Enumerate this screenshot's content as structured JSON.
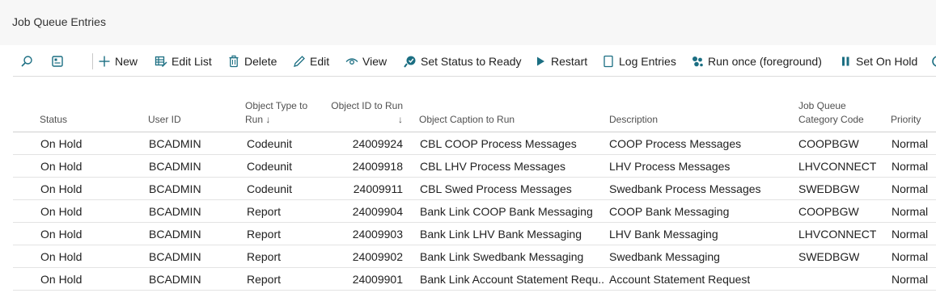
{
  "page": {
    "title": "Job Queue Entries"
  },
  "toolbar": {
    "search_icon": "search-icon",
    "layout_icon": "layout-icon",
    "actions": [
      {
        "label": "New",
        "icon": "plus-icon"
      },
      {
        "label": "Edit List",
        "icon": "edit-list-icon"
      },
      {
        "label": "Delete",
        "icon": "trash-icon"
      },
      {
        "label": "Edit",
        "icon": "pencil-icon"
      },
      {
        "label": "View",
        "icon": "eye-icon"
      },
      {
        "label": "Set Status to Ready",
        "icon": "status-ready-icon"
      },
      {
        "label": "Restart",
        "icon": "play-icon"
      },
      {
        "label": "Log Entries",
        "icon": "log-icon"
      },
      {
        "label": "Run once (foreground)",
        "icon": "run-once-icon"
      },
      {
        "label": "Set On Hold",
        "icon": "pause-icon"
      }
    ],
    "accent": "#1b6e82"
  },
  "table": {
    "headers": {
      "status": "Status",
      "user_id": "User ID",
      "object_type": "Object Type to Run ↓",
      "object_id": "Object ID to Run ↓",
      "caption": "Object Caption to Run",
      "description": "Description",
      "category": "Job Queue Category Code",
      "priority": "Priority"
    },
    "rows": [
      {
        "status": "On Hold",
        "user_id": "BCADMIN",
        "object_type": "Codeunit",
        "object_id": "24009924",
        "caption": "CBL COOP Process Messages",
        "description": "COOP Process Messages",
        "category": "COOPBGW",
        "priority": "Normal"
      },
      {
        "status": "On Hold",
        "user_id": "BCADMIN",
        "object_type": "Codeunit",
        "object_id": "24009918",
        "caption": "CBL LHV Process Messages",
        "description": "LHV Process Messages",
        "category": "LHVCONNECT",
        "priority": "Normal"
      },
      {
        "status": "On Hold",
        "user_id": "BCADMIN",
        "object_type": "Codeunit",
        "object_id": "24009911",
        "caption": "CBL Swed Process Messages",
        "description": "Swedbank Process Messages",
        "category": "SWEDBGW",
        "priority": "Normal"
      },
      {
        "status": "On Hold",
        "user_id": "BCADMIN",
        "object_type": "Report",
        "object_id": "24009904",
        "caption": "Bank Link COOP Bank Messaging",
        "description": "COOP Bank Messaging",
        "category": "COOPBGW",
        "priority": "Normal"
      },
      {
        "status": "On Hold",
        "user_id": "BCADMIN",
        "object_type": "Report",
        "object_id": "24009903",
        "caption": "Bank Link LHV Bank Messaging",
        "description": "LHV Bank Messaging",
        "category": "LHVCONNECT",
        "priority": "Normal"
      },
      {
        "status": "On Hold",
        "user_id": "BCADMIN",
        "object_type": "Report",
        "object_id": "24009902",
        "caption": "Bank Link Swedbank Messaging",
        "description": "Swedbank Messaging",
        "category": "SWEDBGW",
        "priority": "Normal"
      },
      {
        "status": "On Hold",
        "user_id": "BCADMIN",
        "object_type": "Report",
        "object_id": "24009901",
        "caption": "Bank Link Account Statement Requ...",
        "description": "Account Statement Request",
        "category": "",
        "priority": "Normal"
      }
    ]
  }
}
